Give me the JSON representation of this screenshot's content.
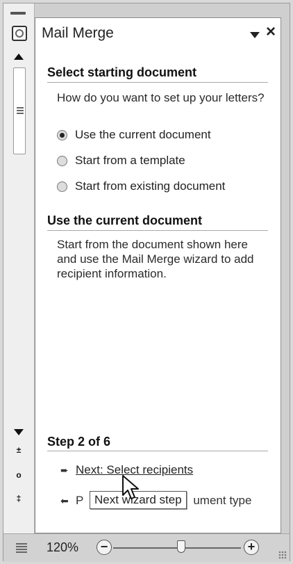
{
  "pane": {
    "title": "Mail Merge",
    "section1": {
      "heading": "Select starting document",
      "question": "How do you want to set up your letters?",
      "options": [
        {
          "label": "Use the current document",
          "selected": true
        },
        {
          "label": "Start from a template",
          "selected": false
        },
        {
          "label": "Start from existing document",
          "selected": false
        }
      ]
    },
    "section2": {
      "heading": "Use the current document",
      "description": "Start from the document shown here and use the Mail Merge wizard to add recipient information."
    },
    "step": {
      "label": "Step 2 of 6",
      "next_link": "Next: Select recipients",
      "prev_link_visible_start": "P",
      "prev_link_visible_end": "ument type"
    },
    "tooltip": "Next wizard step"
  },
  "statusbar": {
    "zoom": "120%",
    "zoom_out": "−",
    "zoom_in": "+"
  },
  "icons": {
    "pane_icon": "mail-merge-icon",
    "dropdown": "chevron-down-icon",
    "close": "close-icon",
    "scroll_up": "triangle-up-icon",
    "scroll_down": "triangle-down-icon",
    "next": "arrow-right-icon",
    "prev": "arrow-left-icon",
    "cursor": "mouse-pointer-icon"
  }
}
